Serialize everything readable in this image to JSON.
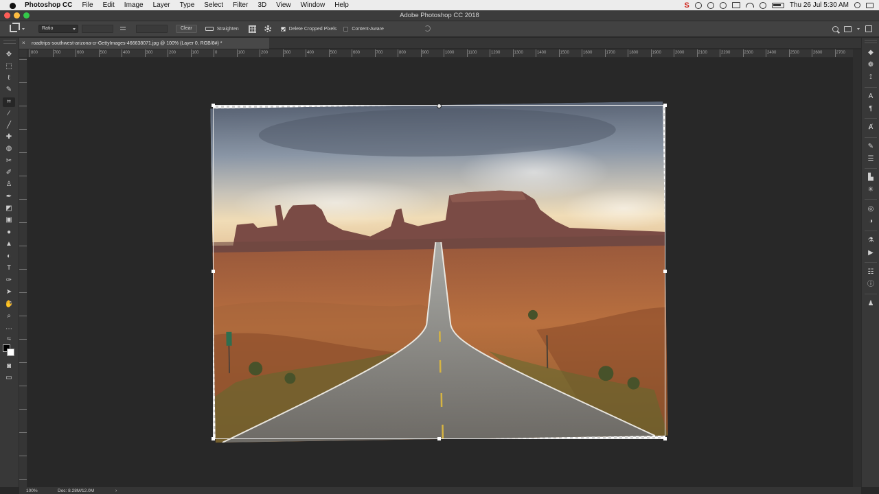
{
  "menubar": {
    "app_name": "Photoshop CC",
    "items": [
      "File",
      "Edit",
      "Image",
      "Layer",
      "Type",
      "Select",
      "Filter",
      "3D",
      "View",
      "Window",
      "Help"
    ],
    "clock": "Thu 26 Jul  5:30 AM"
  },
  "window": {
    "title": "Adobe Photoshop CC 2018"
  },
  "options": {
    "ratio_select": "Ratio",
    "clear_label": "Clear",
    "straighten_label": "Straighten",
    "delete_cropped_label": "Delete Cropped Pixels",
    "delete_cropped_checked": true,
    "content_aware_label": "Content-Aware",
    "content_aware_checked": false
  },
  "document": {
    "tab_title": "roadtrips-southwest-arizona-cr-GettyImages-466638071.jpg @ 100% (Layer 0, RGB/8#) *"
  },
  "ruler": {
    "h_labels": [
      "800",
      "700",
      "600",
      "500",
      "400",
      "300",
      "200",
      "100",
      "0",
      "100",
      "200",
      "300",
      "400",
      "500",
      "600",
      "700",
      "800",
      "900",
      "1000",
      "1100",
      "1200",
      "1300",
      "1400",
      "1500",
      "1600",
      "1700",
      "1800",
      "1900",
      "2000",
      "2100",
      "2200",
      "2300",
      "2400",
      "2500",
      "2600",
      "2700"
    ]
  },
  "status": {
    "zoom": "100%",
    "doc_size": "Doc: 8.28M/12.0M",
    "arrow": "›"
  },
  "colors": {
    "foreground": "#000000",
    "background": "#ffffff",
    "chrome_dark": "#282828"
  },
  "tools": [
    "move-tool",
    "marquee-tool",
    "lasso-tool",
    "quick-select-tool",
    "crop-tool",
    "eyedropper-tool",
    "healing-tool",
    "brush-tool",
    "clone-stamp-tool",
    "history-brush-tool",
    "eraser-tool",
    "gradient-tool",
    "blur-tool",
    "dodge-tool",
    "pen-tool",
    "type-tool",
    "path-select-tool",
    "rectangle-tool",
    "hand-tool",
    "zoom-tool",
    "more-tools"
  ],
  "active_tool": "crop-tool"
}
